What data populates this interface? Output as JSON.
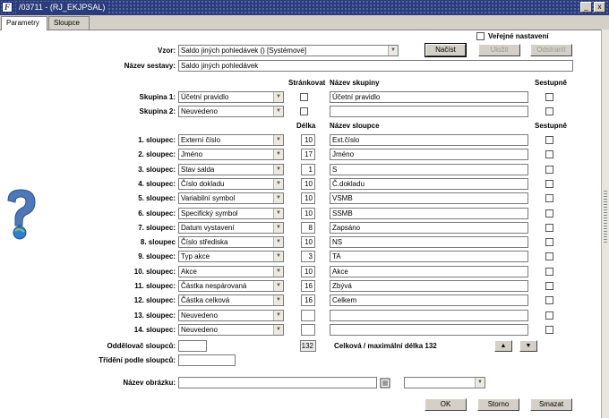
{
  "window": {
    "title": "/03711 - (RJ_EKJPSAL)",
    "app_icon": "F",
    "min": "_",
    "close": "x"
  },
  "tabs": [
    "Parametry",
    "Sloupce"
  ],
  "public_setting": "Veřejné nastavení",
  "vzor_label": "Vzor:",
  "vzor_value": "Saldo jiných pohledávek  ()  [Systémové]",
  "buttons": {
    "load": "Načíst",
    "save": "Uložit",
    "remove": "Odstranit",
    "ok": "OK",
    "cancel": "Storno",
    "delete": "Smazat"
  },
  "nazev_sestavy_label": "Název sestavy:",
  "nazev_sestavy_value": "Saldo jiných pohledávek",
  "group_headers": {
    "paging": "Stránkovat",
    "group_name": "Název skupiny",
    "desc": "Sestupně"
  },
  "groups": [
    {
      "label": "Skupina 1:",
      "value": "Účetní pravidlo",
      "name": "Účetní pravidlo"
    },
    {
      "label": "Skupina 2:",
      "value": "Neuvedeno",
      "name": ""
    }
  ],
  "col_headers": {
    "length": "Délka",
    "col_name": "Název sloupce",
    "desc": "Sestupně"
  },
  "columns": [
    {
      "label": "1. sloupec:",
      "value": "Externí číslo",
      "len": "10",
      "name": "Ext.číslo"
    },
    {
      "label": "2. sloupec:",
      "value": "Jméno",
      "len": "17",
      "name": "Jméno"
    },
    {
      "label": "3. sloupec:",
      "value": "Stav salda",
      "len": "1",
      "name": "S"
    },
    {
      "label": "4. sloupec:",
      "value": "Číslo dokladu",
      "len": "10",
      "name": "Č.dokladu"
    },
    {
      "label": "5. sloupec:",
      "value": "Variabilní symbol",
      "len": "10",
      "name": "VSMB"
    },
    {
      "label": "6. sloupec:",
      "value": "Specifický symbol",
      "len": "10",
      "name": "SSMB"
    },
    {
      "label": "7. sloupec:",
      "value": "Datum vystavení",
      "len": "8",
      "name": "Zapsáno"
    },
    {
      "label": "8. sloupec",
      "value": "Číslo střediska",
      "len": "10",
      "name": "NS"
    },
    {
      "label": "9. sloupec:",
      "value": "Typ akce",
      "len": "3",
      "name": "TA"
    },
    {
      "label": "10. sloupec:",
      "value": "Akce",
      "len": "10",
      "name": "Akce"
    },
    {
      "label": "11. sloupec:",
      "value": "Částka nespárovaná",
      "len": "16",
      "name": "Zbývá"
    },
    {
      "label": "12. sloupec:",
      "value": "Částka celková",
      "len": "16",
      "name": "Celkem"
    },
    {
      "label": "13. sloupec:",
      "value": "Neuvedeno",
      "len": "",
      "name": ""
    },
    {
      "label": "14. sloupec:",
      "value": "Neuvedeno",
      "len": "",
      "name": ""
    }
  ],
  "separator_label": "Oddělovač sloupců:",
  "total_len": "132",
  "total_text": "Celková / maximální délka 132",
  "sort_label": "Třídění podle sloupců:",
  "image_label": "Název obrázku:",
  "icons": {
    "help": "question-mark-icon",
    "up": "▲",
    "down": "▼",
    "browse": "list-icon"
  }
}
